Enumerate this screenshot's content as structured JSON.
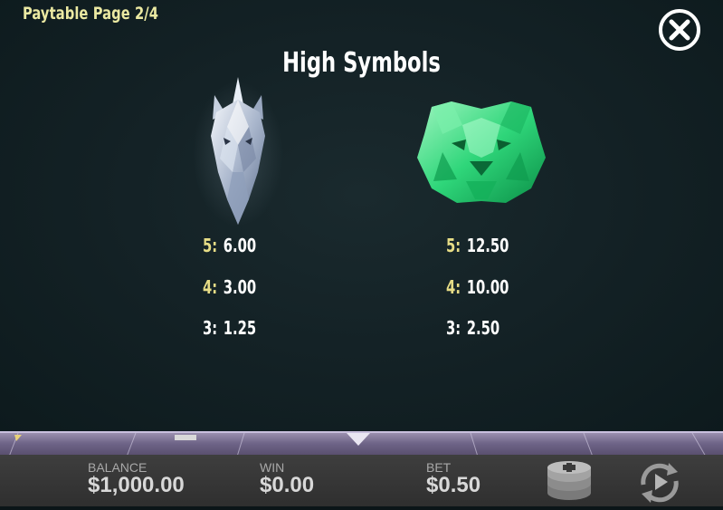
{
  "header": {
    "page_label": "Paytable Page 2/4",
    "close_icon": "close-circle-icon"
  },
  "section": {
    "title": "High Symbols"
  },
  "symbols": [
    {
      "name": "crystal-unicorn",
      "pays": [
        {
          "count": "5:",
          "value": "6.00"
        },
        {
          "count": "4:",
          "value": "3.00"
        },
        {
          "count": "3:",
          "value": "1.25"
        }
      ]
    },
    {
      "name": "emerald-tiger",
      "pays": [
        {
          "count": "5:",
          "value": "12.50"
        },
        {
          "count": "4:",
          "value": "10.00"
        },
        {
          "count": "3:",
          "value": "2.50"
        }
      ]
    }
  ],
  "footer": {
    "balance_label": "BALANCE",
    "balance_value": "$1,000.00",
    "win_label": "WIN",
    "win_value": "$0.00",
    "bet_label": "BET",
    "bet_value": "$0.50",
    "coins_icon": "coin-stack-plus-icon",
    "spin_icon": "spin-arrow-icon"
  },
  "colors": {
    "count_yellow": "#e7dd86",
    "page_label": "#ebe9a2",
    "background": "#142226"
  }
}
